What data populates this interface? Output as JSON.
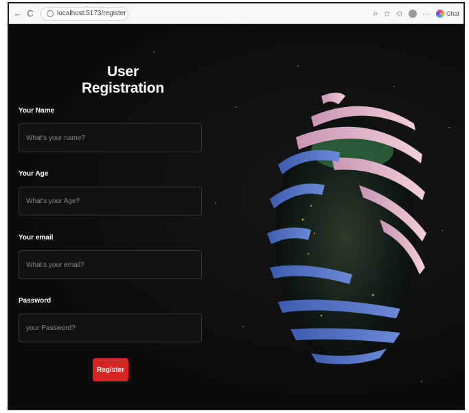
{
  "browser": {
    "url": "localhost:5173/register",
    "chat_label": "Chat"
  },
  "form": {
    "title": "User Registration",
    "fields": [
      {
        "label": "Your Name",
        "placeholder": "What's your name?"
      },
      {
        "label": "Your Age",
        "placeholder": "What's your Age?"
      },
      {
        "label": "Your email",
        "placeholder": "What's your email?"
      },
      {
        "label": "Password",
        "placeholder": "your Password?"
      }
    ],
    "submit_label": "Register"
  },
  "colors": {
    "background": "#0e0e0e",
    "accent": "#d82424",
    "globe_pink": "#e4b6c8",
    "globe_blue": "#4a6fc4"
  }
}
